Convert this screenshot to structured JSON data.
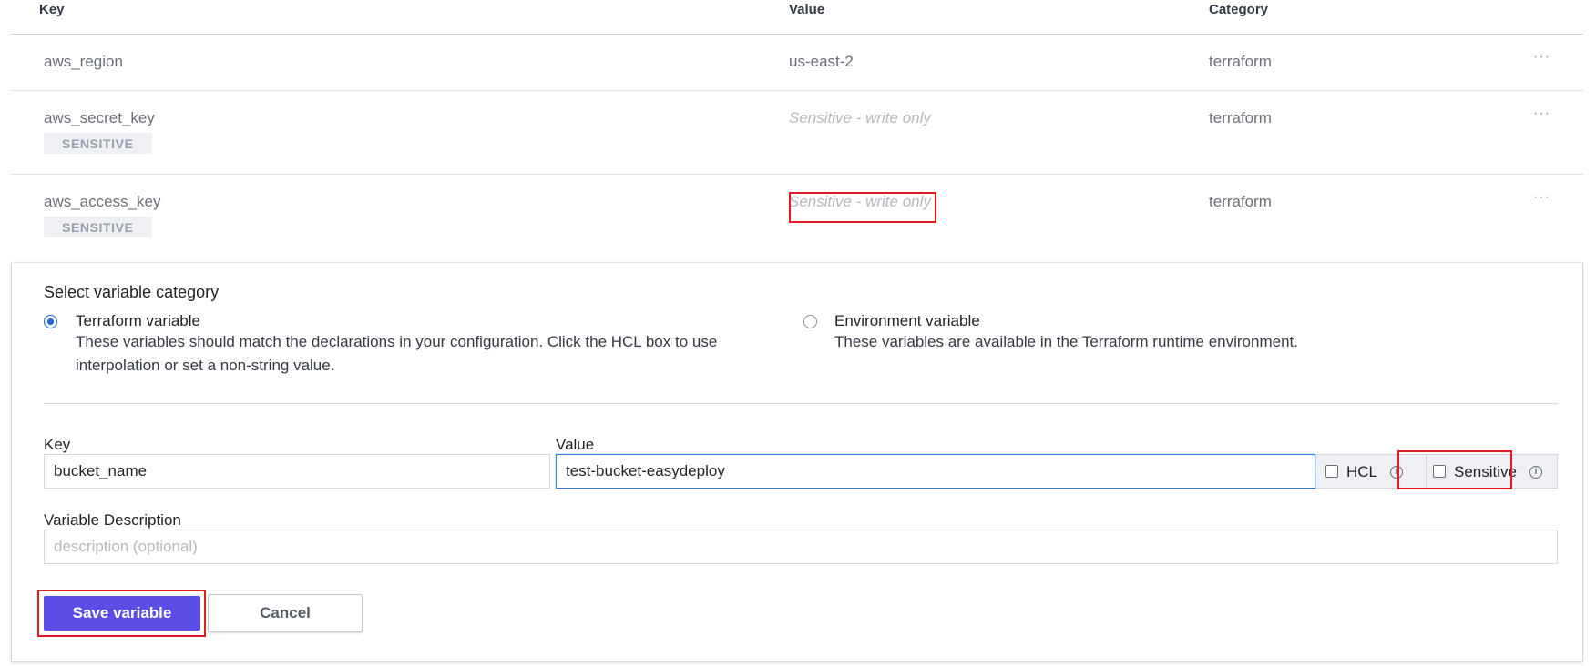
{
  "table": {
    "headers": {
      "key": "Key",
      "value": "Value",
      "category": "Category"
    },
    "rows": [
      {
        "key": "aws_region",
        "value": "us-east-2",
        "category": "terraform",
        "more": "···"
      },
      {
        "key": "aws_secret_key",
        "badge": "SENSITIVE",
        "value": "Sensitive - write only",
        "category": "terraform",
        "more": "···"
      },
      {
        "key": "aws_access_key",
        "badge": "SENSITIVE",
        "value": "Sensitive - write only",
        "category": "terraform",
        "more": "···"
      }
    ]
  },
  "form": {
    "section_title": "Select variable category",
    "options": [
      {
        "title": "Terraform variable",
        "desc_line1": "These variables should match the declarations in your configuration. Click the HCL box to use",
        "desc_line2": "interpolation or set a non-string value.",
        "selected": true
      },
      {
        "title": "Environment variable",
        "desc_line1": "These variables are available in the Terraform runtime environment.",
        "selected": false
      }
    ],
    "key_label": "Key",
    "key_value": "bucket_name",
    "value_label": "Value",
    "value_value": "test-bucket-easydeploy",
    "hcl_label": "HCL",
    "sensitive_label": "Sensitive",
    "info_glyph": "i",
    "description_label": "Variable Description",
    "description_placeholder": "description (optional)",
    "save_label": "Save variable",
    "cancel_label": "Cancel"
  },
  "colors": {
    "primary": "#5c4ee5",
    "highlight": "#e01b24",
    "radio_selected": "#1f67d6",
    "focus_border": "#2f7de1"
  },
  "icons": {
    "more": "ellipsis-icon",
    "info": "info-icon"
  }
}
